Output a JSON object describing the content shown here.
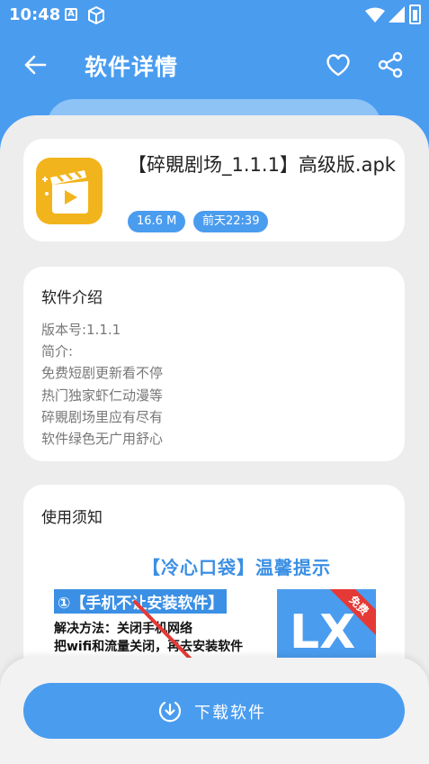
{
  "status_bar": {
    "time": "10:48",
    "notif_letter": "A"
  },
  "appbar": {
    "title": "软件详情"
  },
  "app": {
    "name": "【碎覞剧场_1.1.1】高级版.apk",
    "size": "16.6 M",
    "date": "前天22:39"
  },
  "intro": {
    "title": "软件介绍",
    "lines": [
      "版本号:1.1.1",
      "简介:",
      "免费短剧更新看不停",
      "热门独家虾仁动漫等",
      "碎覞剧场里应有尽有",
      "软件绿色无广用舒心"
    ]
  },
  "notice": {
    "title": "使用须知",
    "poster": {
      "title": "【冷心口袋】温馨提示",
      "highlight": "①【手机不让安装软件】",
      "solution_1": "解决方法：关闭手机网络",
      "solution_2": "把wifi和流量关闭，再去安装软件",
      "logo_text": "LX",
      "logo_ribbon": "免费"
    }
  },
  "download": {
    "label": "下载软件"
  },
  "colors": {
    "accent": "#4a9cef",
    "poster_blue": "#3b8fe4",
    "ribbon_red": "#e53935",
    "arrow_red": "#e53935",
    "app_icon_bg": "#f2b41c"
  }
}
